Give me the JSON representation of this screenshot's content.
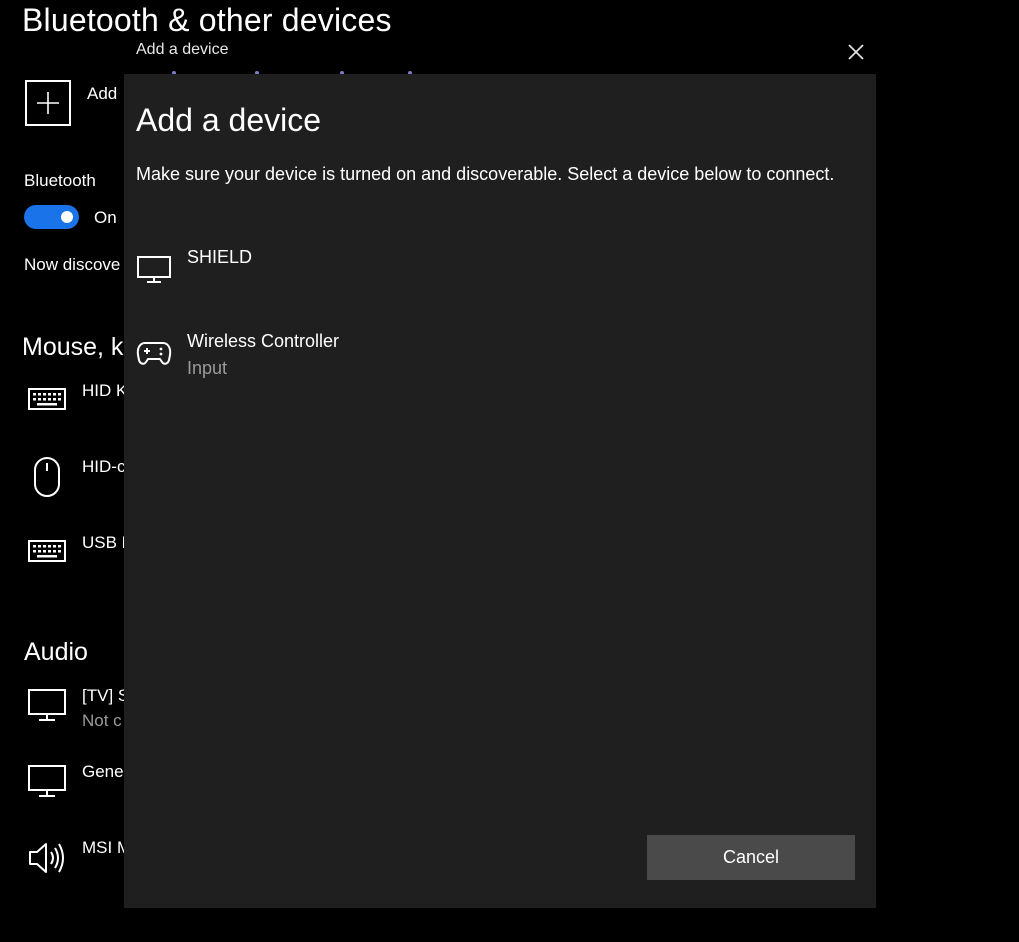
{
  "settings": {
    "title": "Bluetooth & other devices",
    "add_label": "Add",
    "bluetooth": {
      "label": "Bluetooth",
      "toggle_state": "On",
      "discover_text": "Now discove"
    },
    "sections": [
      {
        "heading": "Mouse, ke",
        "devices": [
          {
            "name": "HID K",
            "icon": "keyboard-icon"
          },
          {
            "name": "HID-c",
            "icon": "mouse-icon"
          },
          {
            "name": "USB F",
            "icon": "keyboard-icon"
          }
        ]
      },
      {
        "heading": "Audio",
        "devices": [
          {
            "name": "[TV] S",
            "status": "Not c",
            "icon": "monitor-icon"
          },
          {
            "name": "Gener",
            "icon": "monitor-icon"
          },
          {
            "name": "MSI M",
            "icon": "speaker-icon"
          }
        ]
      }
    ]
  },
  "dialog": {
    "window_title": "Add a device",
    "heading": "Add a device",
    "instructions": "Make sure your device is turned on and discoverable. Select a device below to connect.",
    "devices": [
      {
        "name": "SHIELD",
        "type": "",
        "icon": "monitor-icon"
      },
      {
        "name": "Wireless Controller",
        "type": "Input",
        "icon": "gamepad-icon"
      }
    ],
    "cancel_label": "Cancel"
  },
  "colors": {
    "toggle_on": "#1a73e8",
    "dialog_bg": "#1f1f1f",
    "button_bg": "#4a4a4a",
    "secondary_text": "#9a9a9a",
    "progress_dots": "#7c7cc6"
  }
}
